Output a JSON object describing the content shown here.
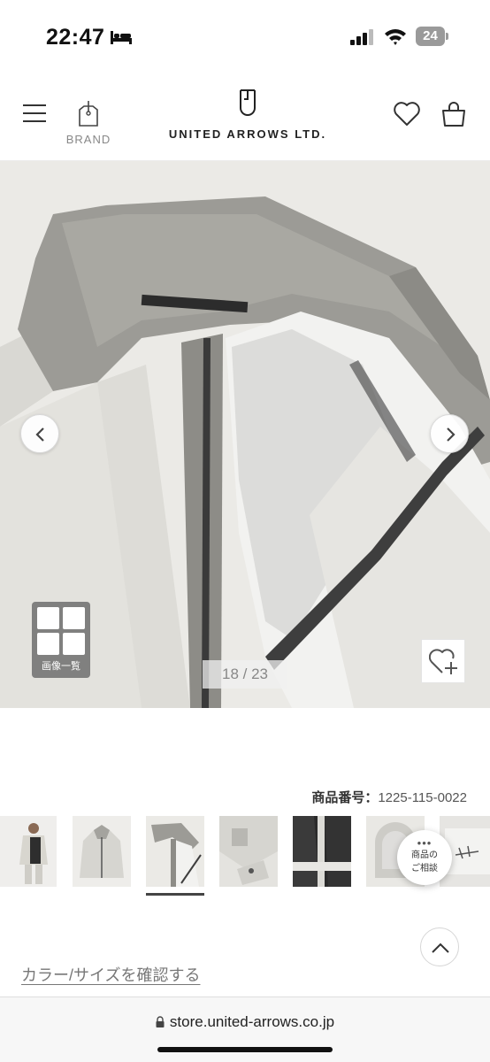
{
  "status_bar": {
    "time": "22:47",
    "battery": "24"
  },
  "header": {
    "brand_label": "BRAND",
    "logo_text": "UNITED ARROWS LTD."
  },
  "gallery": {
    "current": "18",
    "total": "23",
    "counter_separator": " / ",
    "grid_label": "画像一覧"
  },
  "product": {
    "number_label": "商品番号：",
    "number_value": "1225-115-0022"
  },
  "chat": {
    "line1": "商品の",
    "line2": "ご相談"
  },
  "links": {
    "color_size": "カラー/サイズを確認する"
  },
  "browser": {
    "url": "store.united-arrows.co.jp"
  },
  "icons": [
    "bed-icon",
    "signal-icon",
    "wifi-icon",
    "menu-icon",
    "brand-bag-icon",
    "logo-mark",
    "heart-icon",
    "bag-icon",
    "chevron-left-icon",
    "chevron-right-icon",
    "grid-icon",
    "favorite-add-icon",
    "chevron-up-icon",
    "lock-icon"
  ]
}
